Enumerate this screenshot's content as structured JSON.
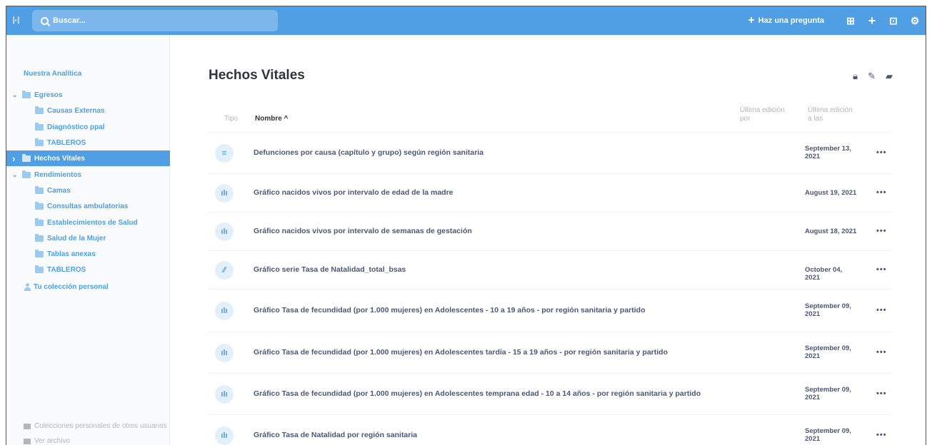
{
  "topbar": {
    "logo": "ℍ",
    "search_placeholder": "Buscar...",
    "ask_label": "Haz una pregunta",
    "ask_icon": "plus-icon",
    "icons": [
      "grid-icon",
      "plus-icon",
      "browse-icon",
      "gear-icon"
    ]
  },
  "sidebar": {
    "root_label": "Nuestra Analítica",
    "items": [
      {
        "label": "Egresos",
        "chevron": "v",
        "level": 0
      },
      {
        "label": "Causas Externas",
        "chevron": "",
        "level": 1
      },
      {
        "label": "Diagnóstico ppal",
        "chevron": "",
        "level": 1
      },
      {
        "label": "TABLEROS",
        "chevron": "",
        "level": 1
      },
      {
        "label": "Hechos Vitales",
        "chevron": ">",
        "level": 0,
        "active": true
      },
      {
        "label": "Rendimientos",
        "chevron": "v",
        "level": 0
      },
      {
        "label": "Camas",
        "chevron": "",
        "level": 1
      },
      {
        "label": "Consultas ambulatorias",
        "chevron": "",
        "level": 1
      },
      {
        "label": "Establecimientos de Salud",
        "chevron": "",
        "level": 1
      },
      {
        "label": "Salud de la Mujer",
        "chevron": "",
        "level": 1
      },
      {
        "label": "Tablas anexas",
        "chevron": "",
        "level": 1
      },
      {
        "label": "TABLEROS",
        "chevron": "",
        "level": 1
      }
    ],
    "personal_label": "Tu colección personal",
    "other_users_label": "Colecciones personales de otros usuarios",
    "archive_label": "Ver archivo"
  },
  "main": {
    "title": "Hechos Vitales",
    "actions": [
      "lock-icon",
      "pencil-icon",
      "move-folder-icon"
    ],
    "columns": {
      "type": "Tipo",
      "name": "Nombre ^",
      "edited_by": "Última edición por",
      "edited_at": "Última edición a las"
    },
    "rows": [
      {
        "icon": "table-icon",
        "glyph": "≡",
        "name": "Defunciones por causa (capítulo y grupo) según región sanitaria",
        "date": "September 13, 2021",
        "more": "•••"
      },
      {
        "icon": "bar-chart-icon",
        "glyph": "ılı",
        "name": "Gráfico nacidos vivos por intervalo de edad de la madre",
        "date": "August 19, 2021",
        "more": "•••"
      },
      {
        "icon": "bar-chart-icon",
        "glyph": "ılı",
        "name": "Gráfico nacidos vivos por intervalo de semanas de gestación",
        "date": "August 18, 2021",
        "more": "•••"
      },
      {
        "icon": "line-chart-icon",
        "glyph": "∕∕",
        "name": "Gráfico serie Tasa de Natalidad_total_bsas",
        "date": "October 04, 2021",
        "more": "•••"
      },
      {
        "icon": "bar-chart-icon",
        "glyph": "ılı",
        "name": "Gráfico Tasa de fecundidad (por 1.000 mujeres) en Adolescentes - 10 a 19 años - por región sanitaria y partido",
        "date": "September 09, 2021",
        "more": "•••"
      },
      {
        "icon": "bar-chart-icon",
        "glyph": "ılı",
        "name": "Gráfico Tasa de fecundidad (por 1.000 mujeres) en Adolescentes tardía - 15 a 19 años - por región sanitaria y partido",
        "date": "September 09, 2021",
        "more": "•••"
      },
      {
        "icon": "bar-chart-icon",
        "glyph": "ılı",
        "name": "Gráfico Tasa de fecundidad (por 1.000 mujeres) en Adolescentes temprana edad - 10 a 14 años - por región sanitaria y partido",
        "date": "September 09, 2021",
        "more": "•••"
      },
      {
        "icon": "bar-chart-icon",
        "glyph": "ılı",
        "name": "Gráfico Tasa de Natalidad por región sanitaria",
        "date": "September 09, 2021",
        "more": "•••"
      }
    ]
  }
}
